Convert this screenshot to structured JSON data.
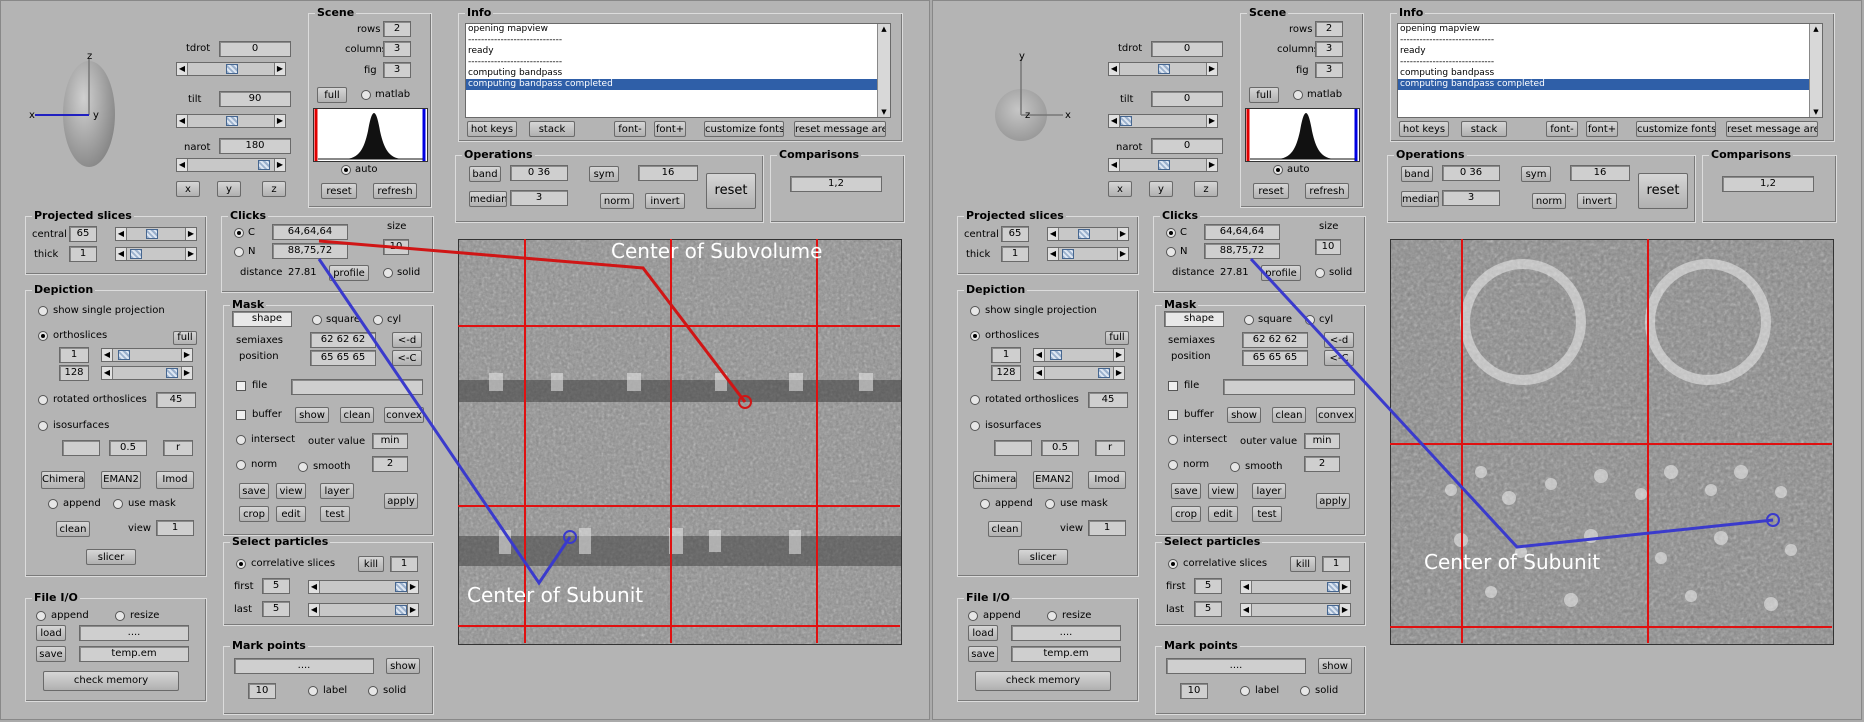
{
  "panels": [
    {
      "axes": {
        "top": "z",
        "left": "x",
        "inner": "y"
      },
      "rotation": {
        "tdrot_label": "tdrot",
        "tdrot_value": "0",
        "tilt_label": "tilt",
        "tilt_value": "90",
        "narot_label": "narot",
        "narot_value": "180",
        "x_btn": "x",
        "y_btn": "y",
        "z_btn": "z"
      },
      "scene": {
        "title": "Scene",
        "rows_label": "rows",
        "rows": "2",
        "columns_label": "columns",
        "columns": "3",
        "fig_label": "fig",
        "fig": "3",
        "full": "full",
        "matlab": "matlab",
        "auto": "auto",
        "reset": "reset",
        "refresh": "refresh"
      },
      "info": {
        "title": "Info",
        "lines": [
          "opening mapview",
          "-----------------------------",
          "ready",
          "-----------------------------",
          "computing bandpass",
          "computing bandpass completed"
        ],
        "buttons": [
          "hot keys",
          "stack",
          "font-",
          "font+",
          "customize fonts",
          "reset message area"
        ]
      },
      "operations": {
        "title": "Operations",
        "band": "band",
        "band_value": "0  36",
        "sym": "sym",
        "sym_value": "16",
        "median": "median",
        "median_value": "3",
        "norm": "norm",
        "invert": "invert",
        "reset": "reset"
      },
      "comparisons": {
        "title": "Comparisons",
        "value": "1,2"
      },
      "projected": {
        "title": "Projected slices",
        "central_label": "central",
        "central": "65",
        "thick_label": "thick",
        "thick": "1"
      },
      "clicks": {
        "title": "Clicks",
        "c_label": "C",
        "c_value": "64,64,64",
        "n_label": "N",
        "n_value": "88,75,72",
        "size_label": "size",
        "size": "10",
        "distance_label": "distance",
        "distance": "27.81",
        "profile": "profile",
        "solid": "solid"
      },
      "depiction": {
        "title": "Depiction",
        "show_single": "show single projection",
        "orthoslices": "orthoslices",
        "full": "full",
        "ortho_a": "1",
        "ortho_b": "128",
        "rotated": "rotated orthoslices",
        "rotated_value": "45",
        "isosurfaces": "isosurfaces",
        "iso_a": "",
        "iso_b": "0.5",
        "iso_r": "r",
        "chimera": "Chimera",
        "eman2": "EMAN2",
        "imod": "Imod",
        "append": "append",
        "use_mask": "use mask",
        "clean": "clean",
        "view_label": "view",
        "view": "1",
        "slicer": "slicer"
      },
      "mask": {
        "title": "Mask",
        "shape": "shape",
        "square": "square",
        "cyl": "cyl",
        "semiaxes_label": "semiaxes",
        "semiaxes": "62  62  62",
        "semi_btn": "<-d",
        "position_label": "position",
        "position": "65  65  65",
        "pos_btn": "<-C",
        "file": "file",
        "buffer": "buffer",
        "show": "show",
        "clean": "clean",
        "convex": "convex",
        "intersect": "intersect",
        "outer_value_label": "outer value",
        "outer_value": "min",
        "norm": "norm",
        "smooth": "smooth",
        "smooth_value": "2",
        "save": "save",
        "view": "view",
        "layer": "layer",
        "crop": "crop",
        "edit": "edit",
        "test": "test",
        "apply": "apply"
      },
      "select": {
        "title": "Select particles",
        "correlative": "correlative slices",
        "kill": "kill",
        "kill_value": "1",
        "first_label": "first",
        "first": "5",
        "last_label": "last",
        "last": "5"
      },
      "fileio": {
        "title": "File I/O",
        "append": "append",
        "resize": "resize",
        "load": "load",
        "load_value": "....",
        "save": "save",
        "save_value": "temp.em",
        "check_memory": "check memory"
      },
      "mark": {
        "title": "Mark points",
        "value": "....",
        "show": "show",
        "count": "10",
        "label": "label",
        "solid": "solid"
      },
      "annotations": {
        "subvolume": "Center of Subvolume",
        "subunit": "Center of Subunit"
      }
    },
    {
      "axes": {
        "top": "y",
        "left": "z",
        "right": "x"
      },
      "rotation": {
        "tdrot_label": "tdrot",
        "tdrot_value": "0",
        "tilt_label": "tilt",
        "tilt_value": "0",
        "narot_label": "narot",
        "narot_value": "0",
        "x_btn": "x",
        "y_btn": "y",
        "z_btn": "z"
      },
      "scene": {
        "title": "Scene",
        "rows_label": "rows",
        "rows": "2",
        "columns_label": "columns",
        "columns": "3",
        "fig_label": "fig",
        "fig": "3",
        "full": "full",
        "matlab": "matlab",
        "auto": "auto",
        "reset": "reset",
        "refresh": "refresh"
      },
      "info": {
        "title": "Info",
        "lines": [
          "opening mapview",
          "-----------------------------",
          "ready",
          "-----------------------------",
          "computing bandpass",
          "computing bandpass completed"
        ],
        "buttons": [
          "hot keys",
          "stack",
          "font-",
          "font+",
          "customize fonts",
          "reset message area"
        ]
      },
      "operations": {
        "title": "Operations",
        "band": "band",
        "band_value": "0  36",
        "sym": "sym",
        "sym_value": "16",
        "median": "median",
        "median_value": "3",
        "norm": "norm",
        "invert": "invert",
        "reset": "reset"
      },
      "comparisons": {
        "title": "Comparisons",
        "value": "1,2"
      },
      "projected": {
        "title": "Projected slices",
        "central_label": "central",
        "central": "65",
        "thick_label": "thick",
        "thick": "1"
      },
      "clicks": {
        "title": "Clicks",
        "c_label": "C",
        "c_value": "64,64,64",
        "n_label": "N",
        "n_value": "88,75,72",
        "size_label": "size",
        "size": "10",
        "distance_label": "distance",
        "distance": "27.81",
        "profile": "profile",
        "solid": "solid"
      },
      "depiction": {
        "title": "Depiction",
        "show_single": "show single projection",
        "orthoslices": "orthoslices",
        "full": "full",
        "ortho_a": "1",
        "ortho_b": "128",
        "rotated": "rotated orthoslices",
        "rotated_value": "45",
        "isosurfaces": "isosurfaces",
        "iso_a": "",
        "iso_b": "0.5",
        "iso_r": "r",
        "chimera": "Chimera",
        "eman2": "EMAN2",
        "imod": "Imod",
        "append": "append",
        "use_mask": "use mask",
        "clean": "clean",
        "view_label": "view",
        "view": "1",
        "slicer": "slicer"
      },
      "mask": {
        "title": "Mask",
        "shape": "shape",
        "square": "square",
        "cyl": "cyl",
        "semiaxes_label": "semiaxes",
        "semiaxes": "62  62  62",
        "semi_btn": "<-d",
        "position_label": "position",
        "position": "65  65  65",
        "pos_btn": "<-C",
        "file": "file",
        "buffer": "buffer",
        "show": "show",
        "clean": "clean",
        "convex": "convex",
        "intersect": "intersect",
        "outer_value_label": "outer value",
        "outer_value": "min",
        "norm": "norm",
        "smooth": "smooth",
        "smooth_value": "2",
        "save": "save",
        "view": "view",
        "layer": "layer",
        "crop": "crop",
        "edit": "edit",
        "test": "test",
        "apply": "apply"
      },
      "select": {
        "title": "Select particles",
        "correlative": "correlative slices",
        "kill": "kill",
        "kill_value": "1",
        "first_label": "first",
        "first": "5",
        "last_label": "last",
        "last": "5"
      },
      "fileio": {
        "title": "File I/O",
        "append": "append",
        "resize": "resize",
        "load": "load",
        "load_value": "....",
        "save": "save",
        "save_value": "temp.em",
        "check_memory": "check memory"
      },
      "mark": {
        "title": "Mark points",
        "value": "....",
        "show": "show",
        "count": "10",
        "label": "label",
        "solid": "solid"
      },
      "annotations": {
        "subunit": "Center of Subunit"
      }
    }
  ],
  "colors": {
    "grid": "#e01010",
    "center_marker": "#d01515",
    "subunit_marker": "#3a3acc",
    "selection": "#2f5fa8"
  }
}
